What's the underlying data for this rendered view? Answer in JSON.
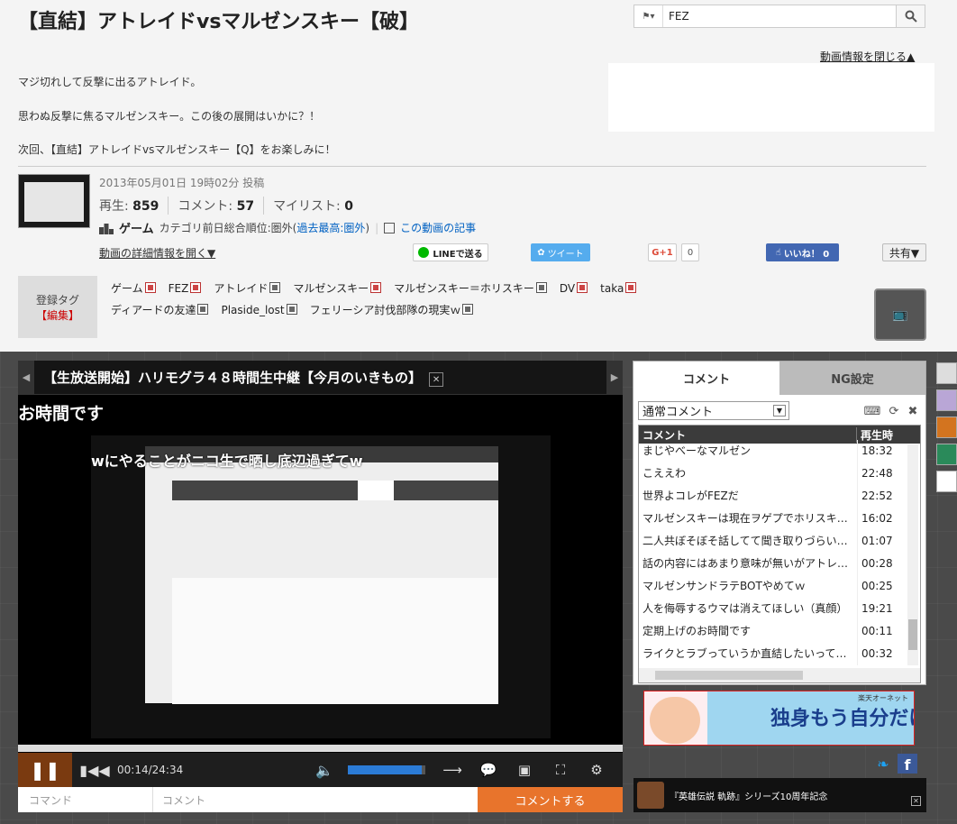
{
  "page": {
    "title": "【直結】アトレイドvsマルゼンスキー【破】"
  },
  "search": {
    "value": "FEZ"
  },
  "info": {
    "close_label": "動画情報を閉じる▲",
    "description": [
      "マジ切れして反撃に出るアトレイド。",
      "思わぬ反撃に焦るマルゼンスキー。この後の展開はいかに？！",
      "次回、【直結】アトレイドvsマルゼンスキー【Q】をお楽しみに！"
    ],
    "post_date": "2013年05月01日 19時02分 投稿",
    "stats": [
      {
        "label": "再生:",
        "value": "859"
      },
      {
        "label": "コメント:",
        "value": "57"
      },
      {
        "label": "マイリスト:",
        "value": "0"
      }
    ],
    "category": "ゲーム",
    "rank_prefix": "カテゴリ前日総合順位:圏外(",
    "rank_link": "過去最高:圏外",
    "rank_suffix": ")",
    "article_link": "この動画の記事",
    "detail_open": "動画の詳細情報を開く▼"
  },
  "share": {
    "line": "LINEで送る",
    "tweet": "ツイート",
    "gplus": "G+1",
    "gplus_count": "0",
    "facebook": "いいね！ 0",
    "menu": "共有▼"
  },
  "tags": {
    "label": "登録タグ",
    "edit": "【編集】",
    "items": [
      {
        "name": "ゲーム",
        "lock": "red"
      },
      {
        "name": "FEZ",
        "lock": "red"
      },
      {
        "name": "アトレイド",
        "lock": "gray"
      },
      {
        "name": "マルゼンスキー",
        "lock": "red"
      },
      {
        "name": "マルゼンスキー＝ホリスキー",
        "lock": "gray"
      },
      {
        "name": "DV",
        "lock": "red"
      },
      {
        "name": "taka",
        "lock": "red"
      },
      {
        "name": "ディアードの友達",
        "lock": "gray"
      },
      {
        "name": "Plaside_lost",
        "lock": "gray"
      },
      {
        "name": "フェリーシア討伐部隊の現実ｗ",
        "lock": "gray"
      }
    ]
  },
  "player": {
    "marquee": "【生放送開始】ハリモグラ４８時間生中継【今月のいきもの】",
    "comment_top": "お時間です",
    "comment_flow": "wにやることがニコ生で晒し底辺過ぎてw",
    "time": "00:14/24:34",
    "volume_fraction": 0.95,
    "command_placeholder": "コマンド",
    "comment_placeholder": "コメント",
    "submit": "コメントする"
  },
  "panel": {
    "tab_comments": "コメント",
    "tab_ng": "NG設定",
    "comment_type": "通常コメント",
    "col_comment": "コメント",
    "col_time": "再生時",
    "rows": [
      {
        "text": "まじやべーなマルゼン",
        "time": "18:32"
      },
      {
        "text": "こええわ",
        "time": "22:48"
      },
      {
        "text": "世界よコレがFEZだ",
        "time": "22:52"
      },
      {
        "text": "マルゼンスキーは現在ヲゲプでホリスキー…",
        "time": "16:02"
      },
      {
        "text": "二人共ぼそぼそ話してて聞き取りづらい…",
        "time": "01:07"
      },
      {
        "text": "話の内容にはあまり意味が無いがアトレ…",
        "time": "00:28"
      },
      {
        "text": "マルゼンサンドラテBOTやめてｗ",
        "time": "00:25"
      },
      {
        "text": "人を侮辱するウマは消えてほしい（真顔）",
        "time": "19:21"
      },
      {
        "text": "定期上げのお時間です",
        "time": "00:11"
      },
      {
        "text": "ライクとラブっていうか直結したいって…",
        "time": "00:32"
      }
    ]
  },
  "banner": {
    "brand": "楽天オーネット",
    "text": "独身もう自分だけ…!?"
  },
  "news": {
    "text": "『英雄伝説 軌跡』シリーズ10周年記念"
  },
  "colors": {
    "accent": "#e8742c",
    "link": "#0061c2",
    "twitter": "#55acee",
    "facebook": "#4267b2"
  }
}
